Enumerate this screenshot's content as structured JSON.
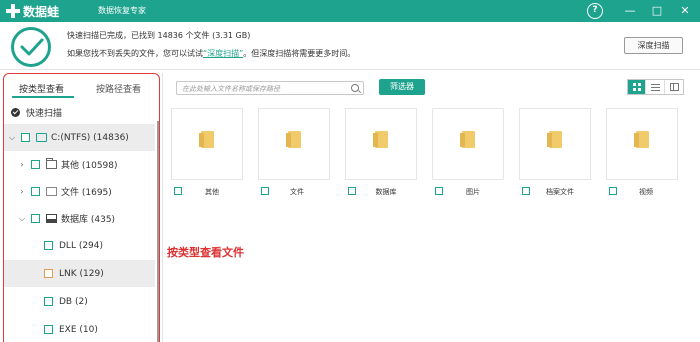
{
  "app": {
    "name": "数据蛙",
    "subtitle": "数据恢复专家",
    "help_symbol": "?",
    "minimize_symbol": "—",
    "maximize_symbol": "□",
    "close_symbol": "✕"
  },
  "status": {
    "line1": "快速扫描已完成，已找到 14836 个文件 (3.31 GB)",
    "line2_prefix": "如果您找不到丢失的文件，您可以试试",
    "line2_link": "“深度扫描”",
    "line2_suffix": "。但深度扫描将需要更多时间。",
    "deep_scan_button": "深度扫描"
  },
  "sidebar": {
    "tabs": [
      "按类型查看",
      "按路径查看"
    ],
    "quick_scan": "快速扫描",
    "tree": [
      {
        "label": "C:(NTFS) (14836)"
      },
      {
        "label": "其他 (10598)"
      },
      {
        "label": "文件 (1695)"
      },
      {
        "label": "数据库 (435)"
      },
      {
        "label": "DLL (294)"
      },
      {
        "label": "LNK (129)"
      },
      {
        "label": "DB (2)"
      },
      {
        "label": "EXE (10)"
      }
    ]
  },
  "toolbar": {
    "search_placeholder": "在此处输入文件名称或保存路径",
    "filter_button": "筛选器"
  },
  "tiles": [
    "其他",
    "文件",
    "数据库",
    "图片",
    "档案文件",
    "视频"
  ],
  "annotation": "按类型查看文件",
  "colors": {
    "accent": "#1ea38f",
    "annotation_red": "#e23a3a",
    "folder": "#f1cb6a"
  }
}
